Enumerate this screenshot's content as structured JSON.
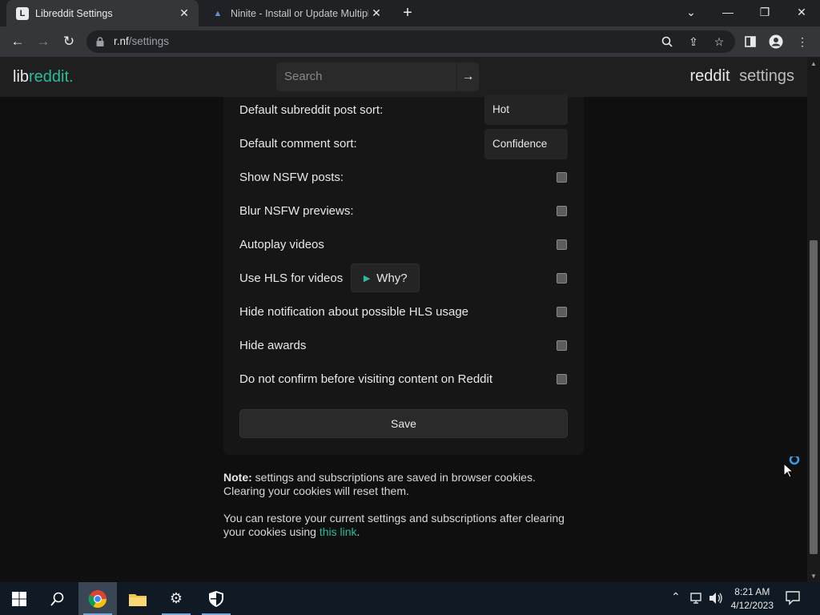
{
  "browser": {
    "tabs": [
      {
        "title": "Libreddit Settings",
        "active": true
      },
      {
        "title": "Ninite - Install or Update Multiple",
        "active": false
      }
    ],
    "url_host": "r.nf",
    "url_path": "/settings"
  },
  "header": {
    "logo_prefix": "lib",
    "logo_accent": "reddit.",
    "search_placeholder": "Search",
    "nav_reddit": "reddit",
    "nav_settings": "settings"
  },
  "settings": {
    "post_sort_label": "Default subreddit post sort:",
    "post_sort_value": "Hot",
    "comment_sort_label": "Default comment sort:",
    "comment_sort_value": "Confidence",
    "show_nsfw": "Show NSFW posts:",
    "blur_nsfw": "Blur NSFW previews:",
    "autoplay": "Autoplay videos",
    "use_hls": "Use HLS for videos",
    "why": "Why?",
    "hide_hls_notif": "Hide notification about possible HLS usage",
    "hide_awards": "Hide awards",
    "no_confirm": "Do not confirm before visiting content on Reddit",
    "save": "Save"
  },
  "notes": {
    "note_bold": "Note:",
    "note_text": " settings and subscriptions are saved in browser cookies. Clearing your cookies will reset them.",
    "restore_text": "You can restore your current settings and subscriptions after clearing your cookies using ",
    "restore_link": "this link",
    "restore_end": "."
  },
  "taskbar": {
    "time": "8:21 AM",
    "date": "4/12/2023"
  },
  "colors": {
    "accent": "#29bc9b",
    "background": "#0f0f0f",
    "panel": "#161616"
  }
}
